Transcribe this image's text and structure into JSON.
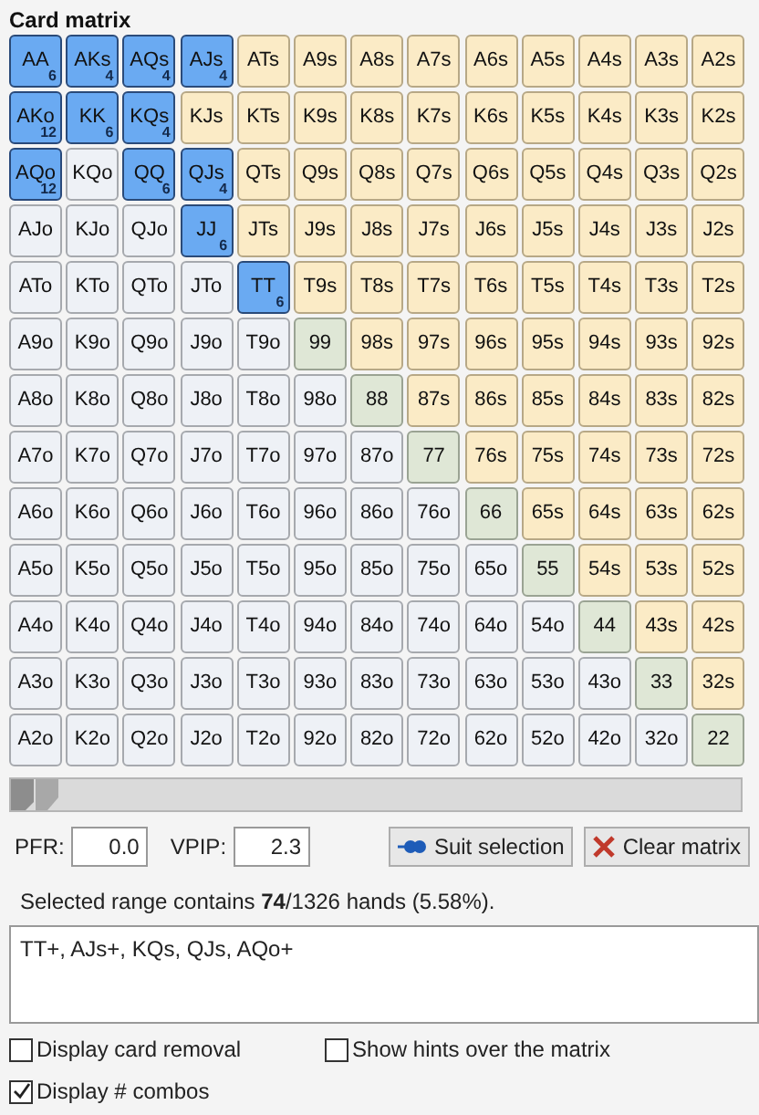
{
  "title": "Card matrix",
  "matrix": [
    [
      {
        "label": "AA",
        "kind": "pair",
        "selected": true,
        "combos": "6"
      },
      {
        "label": "AKs",
        "kind": "suited",
        "selected": true,
        "combos": "4"
      },
      {
        "label": "AQs",
        "kind": "suited",
        "selected": true,
        "combos": "4"
      },
      {
        "label": "AJs",
        "kind": "suited",
        "selected": true,
        "combos": "4"
      },
      {
        "label": "ATs",
        "kind": "suited",
        "selected": false
      },
      {
        "label": "A9s",
        "kind": "suited",
        "selected": false
      },
      {
        "label": "A8s",
        "kind": "suited",
        "selected": false
      },
      {
        "label": "A7s",
        "kind": "suited",
        "selected": false
      },
      {
        "label": "A6s",
        "kind": "suited",
        "selected": false
      },
      {
        "label": "A5s",
        "kind": "suited",
        "selected": false
      },
      {
        "label": "A4s",
        "kind": "suited",
        "selected": false
      },
      {
        "label": "A3s",
        "kind": "suited",
        "selected": false
      },
      {
        "label": "A2s",
        "kind": "suited",
        "selected": false
      }
    ],
    [
      {
        "label": "AKo",
        "kind": "offsuit",
        "selected": true,
        "combos": "12"
      },
      {
        "label": "KK",
        "kind": "pair",
        "selected": true,
        "combos": "6"
      },
      {
        "label": "KQs",
        "kind": "suited",
        "selected": true,
        "combos": "4"
      },
      {
        "label": "KJs",
        "kind": "suited",
        "selected": false
      },
      {
        "label": "KTs",
        "kind": "suited",
        "selected": false
      },
      {
        "label": "K9s",
        "kind": "suited",
        "selected": false
      },
      {
        "label": "K8s",
        "kind": "suited",
        "selected": false
      },
      {
        "label": "K7s",
        "kind": "suited",
        "selected": false
      },
      {
        "label": "K6s",
        "kind": "suited",
        "selected": false
      },
      {
        "label": "K5s",
        "kind": "suited",
        "selected": false
      },
      {
        "label": "K4s",
        "kind": "suited",
        "selected": false
      },
      {
        "label": "K3s",
        "kind": "suited",
        "selected": false
      },
      {
        "label": "K2s",
        "kind": "suited",
        "selected": false
      }
    ],
    [
      {
        "label": "AQo",
        "kind": "offsuit",
        "selected": true,
        "combos": "12"
      },
      {
        "label": "KQo",
        "kind": "offsuit",
        "selected": false
      },
      {
        "label": "QQ",
        "kind": "pair",
        "selected": true,
        "combos": "6"
      },
      {
        "label": "QJs",
        "kind": "suited",
        "selected": true,
        "combos": "4"
      },
      {
        "label": "QTs",
        "kind": "suited",
        "selected": false
      },
      {
        "label": "Q9s",
        "kind": "suited",
        "selected": false
      },
      {
        "label": "Q8s",
        "kind": "suited",
        "selected": false
      },
      {
        "label": "Q7s",
        "kind": "suited",
        "selected": false
      },
      {
        "label": "Q6s",
        "kind": "suited",
        "selected": false
      },
      {
        "label": "Q5s",
        "kind": "suited",
        "selected": false
      },
      {
        "label": "Q4s",
        "kind": "suited",
        "selected": false
      },
      {
        "label": "Q3s",
        "kind": "suited",
        "selected": false
      },
      {
        "label": "Q2s",
        "kind": "suited",
        "selected": false
      }
    ],
    [
      {
        "label": "AJo",
        "kind": "offsuit",
        "selected": false
      },
      {
        "label": "KJo",
        "kind": "offsuit",
        "selected": false
      },
      {
        "label": "QJo",
        "kind": "offsuit",
        "selected": false
      },
      {
        "label": "JJ",
        "kind": "pair",
        "selected": true,
        "combos": "6"
      },
      {
        "label": "JTs",
        "kind": "suited",
        "selected": false
      },
      {
        "label": "J9s",
        "kind": "suited",
        "selected": false
      },
      {
        "label": "J8s",
        "kind": "suited",
        "selected": false
      },
      {
        "label": "J7s",
        "kind": "suited",
        "selected": false
      },
      {
        "label": "J6s",
        "kind": "suited",
        "selected": false
      },
      {
        "label": "J5s",
        "kind": "suited",
        "selected": false
      },
      {
        "label": "J4s",
        "kind": "suited",
        "selected": false
      },
      {
        "label": "J3s",
        "kind": "suited",
        "selected": false
      },
      {
        "label": "J2s",
        "kind": "suited",
        "selected": false
      }
    ],
    [
      {
        "label": "ATo",
        "kind": "offsuit",
        "selected": false
      },
      {
        "label": "KTo",
        "kind": "offsuit",
        "selected": false
      },
      {
        "label": "QTo",
        "kind": "offsuit",
        "selected": false
      },
      {
        "label": "JTo",
        "kind": "offsuit",
        "selected": false
      },
      {
        "label": "TT",
        "kind": "pair",
        "selected": true,
        "combos": "6"
      },
      {
        "label": "T9s",
        "kind": "suited",
        "selected": false
      },
      {
        "label": "T8s",
        "kind": "suited",
        "selected": false
      },
      {
        "label": "T7s",
        "kind": "suited",
        "selected": false
      },
      {
        "label": "T6s",
        "kind": "suited",
        "selected": false
      },
      {
        "label": "T5s",
        "kind": "suited",
        "selected": false
      },
      {
        "label": "T4s",
        "kind": "suited",
        "selected": false
      },
      {
        "label": "T3s",
        "kind": "suited",
        "selected": false
      },
      {
        "label": "T2s",
        "kind": "suited",
        "selected": false
      }
    ],
    [
      {
        "label": "A9o",
        "kind": "offsuit",
        "selected": false
      },
      {
        "label": "K9o",
        "kind": "offsuit",
        "selected": false
      },
      {
        "label": "Q9o",
        "kind": "offsuit",
        "selected": false
      },
      {
        "label": "J9o",
        "kind": "offsuit",
        "selected": false
      },
      {
        "label": "T9o",
        "kind": "offsuit",
        "selected": false
      },
      {
        "label": "99",
        "kind": "pair",
        "selected": false
      },
      {
        "label": "98s",
        "kind": "suited",
        "selected": false
      },
      {
        "label": "97s",
        "kind": "suited",
        "selected": false
      },
      {
        "label": "96s",
        "kind": "suited",
        "selected": false
      },
      {
        "label": "95s",
        "kind": "suited",
        "selected": false
      },
      {
        "label": "94s",
        "kind": "suited",
        "selected": false
      },
      {
        "label": "93s",
        "kind": "suited",
        "selected": false
      },
      {
        "label": "92s",
        "kind": "suited",
        "selected": false
      }
    ],
    [
      {
        "label": "A8o",
        "kind": "offsuit",
        "selected": false
      },
      {
        "label": "K8o",
        "kind": "offsuit",
        "selected": false
      },
      {
        "label": "Q8o",
        "kind": "offsuit",
        "selected": false
      },
      {
        "label": "J8o",
        "kind": "offsuit",
        "selected": false
      },
      {
        "label": "T8o",
        "kind": "offsuit",
        "selected": false
      },
      {
        "label": "98o",
        "kind": "offsuit",
        "selected": false
      },
      {
        "label": "88",
        "kind": "pair",
        "selected": false
      },
      {
        "label": "87s",
        "kind": "suited",
        "selected": false
      },
      {
        "label": "86s",
        "kind": "suited",
        "selected": false
      },
      {
        "label": "85s",
        "kind": "suited",
        "selected": false
      },
      {
        "label": "84s",
        "kind": "suited",
        "selected": false
      },
      {
        "label": "83s",
        "kind": "suited",
        "selected": false
      },
      {
        "label": "82s",
        "kind": "suited",
        "selected": false
      }
    ],
    [
      {
        "label": "A7o",
        "kind": "offsuit",
        "selected": false
      },
      {
        "label": "K7o",
        "kind": "offsuit",
        "selected": false
      },
      {
        "label": "Q7o",
        "kind": "offsuit",
        "selected": false
      },
      {
        "label": "J7o",
        "kind": "offsuit",
        "selected": false
      },
      {
        "label": "T7o",
        "kind": "offsuit",
        "selected": false
      },
      {
        "label": "97o",
        "kind": "offsuit",
        "selected": false
      },
      {
        "label": "87o",
        "kind": "offsuit",
        "selected": false
      },
      {
        "label": "77",
        "kind": "pair",
        "selected": false
      },
      {
        "label": "76s",
        "kind": "suited",
        "selected": false
      },
      {
        "label": "75s",
        "kind": "suited",
        "selected": false
      },
      {
        "label": "74s",
        "kind": "suited",
        "selected": false
      },
      {
        "label": "73s",
        "kind": "suited",
        "selected": false
      },
      {
        "label": "72s",
        "kind": "suited",
        "selected": false
      }
    ],
    [
      {
        "label": "A6o",
        "kind": "offsuit",
        "selected": false
      },
      {
        "label": "K6o",
        "kind": "offsuit",
        "selected": false
      },
      {
        "label": "Q6o",
        "kind": "offsuit",
        "selected": false
      },
      {
        "label": "J6o",
        "kind": "offsuit",
        "selected": false
      },
      {
        "label": "T6o",
        "kind": "offsuit",
        "selected": false
      },
      {
        "label": "96o",
        "kind": "offsuit",
        "selected": false
      },
      {
        "label": "86o",
        "kind": "offsuit",
        "selected": false
      },
      {
        "label": "76o",
        "kind": "offsuit",
        "selected": false
      },
      {
        "label": "66",
        "kind": "pair",
        "selected": false
      },
      {
        "label": "65s",
        "kind": "suited",
        "selected": false
      },
      {
        "label": "64s",
        "kind": "suited",
        "selected": false
      },
      {
        "label": "63s",
        "kind": "suited",
        "selected": false
      },
      {
        "label": "62s",
        "kind": "suited",
        "selected": false
      }
    ],
    [
      {
        "label": "A5o",
        "kind": "offsuit",
        "selected": false
      },
      {
        "label": "K5o",
        "kind": "offsuit",
        "selected": false
      },
      {
        "label": "Q5o",
        "kind": "offsuit",
        "selected": false
      },
      {
        "label": "J5o",
        "kind": "offsuit",
        "selected": false
      },
      {
        "label": "T5o",
        "kind": "offsuit",
        "selected": false
      },
      {
        "label": "95o",
        "kind": "offsuit",
        "selected": false
      },
      {
        "label": "85o",
        "kind": "offsuit",
        "selected": false
      },
      {
        "label": "75o",
        "kind": "offsuit",
        "selected": false
      },
      {
        "label": "65o",
        "kind": "offsuit",
        "selected": false
      },
      {
        "label": "55",
        "kind": "pair",
        "selected": false
      },
      {
        "label": "54s",
        "kind": "suited",
        "selected": false
      },
      {
        "label": "53s",
        "kind": "suited",
        "selected": false
      },
      {
        "label": "52s",
        "kind": "suited",
        "selected": false
      }
    ],
    [
      {
        "label": "A4o",
        "kind": "offsuit",
        "selected": false
      },
      {
        "label": "K4o",
        "kind": "offsuit",
        "selected": false
      },
      {
        "label": "Q4o",
        "kind": "offsuit",
        "selected": false
      },
      {
        "label": "J4o",
        "kind": "offsuit",
        "selected": false
      },
      {
        "label": "T4o",
        "kind": "offsuit",
        "selected": false
      },
      {
        "label": "94o",
        "kind": "offsuit",
        "selected": false
      },
      {
        "label": "84o",
        "kind": "offsuit",
        "selected": false
      },
      {
        "label": "74o",
        "kind": "offsuit",
        "selected": false
      },
      {
        "label": "64o",
        "kind": "offsuit",
        "selected": false
      },
      {
        "label": "54o",
        "kind": "offsuit",
        "selected": false
      },
      {
        "label": "44",
        "kind": "pair",
        "selected": false
      },
      {
        "label": "43s",
        "kind": "suited",
        "selected": false
      },
      {
        "label": "42s",
        "kind": "suited",
        "selected": false
      }
    ],
    [
      {
        "label": "A3o",
        "kind": "offsuit",
        "selected": false
      },
      {
        "label": "K3o",
        "kind": "offsuit",
        "selected": false
      },
      {
        "label": "Q3o",
        "kind": "offsuit",
        "selected": false
      },
      {
        "label": "J3o",
        "kind": "offsuit",
        "selected": false
      },
      {
        "label": "T3o",
        "kind": "offsuit",
        "selected": false
      },
      {
        "label": "93o",
        "kind": "offsuit",
        "selected": false
      },
      {
        "label": "83o",
        "kind": "offsuit",
        "selected": false
      },
      {
        "label": "73o",
        "kind": "offsuit",
        "selected": false
      },
      {
        "label": "63o",
        "kind": "offsuit",
        "selected": false
      },
      {
        "label": "53o",
        "kind": "offsuit",
        "selected": false
      },
      {
        "label": "43o",
        "kind": "offsuit",
        "selected": false
      },
      {
        "label": "33",
        "kind": "pair",
        "selected": false
      },
      {
        "label": "32s",
        "kind": "suited",
        "selected": false
      }
    ],
    [
      {
        "label": "A2o",
        "kind": "offsuit",
        "selected": false
      },
      {
        "label": "K2o",
        "kind": "offsuit",
        "selected": false
      },
      {
        "label": "Q2o",
        "kind": "offsuit",
        "selected": false
      },
      {
        "label": "J2o",
        "kind": "offsuit",
        "selected": false
      },
      {
        "label": "T2o",
        "kind": "offsuit",
        "selected": false
      },
      {
        "label": "92o",
        "kind": "offsuit",
        "selected": false
      },
      {
        "label": "82o",
        "kind": "offsuit",
        "selected": false
      },
      {
        "label": "72o",
        "kind": "offsuit",
        "selected": false
      },
      {
        "label": "62o",
        "kind": "offsuit",
        "selected": false
      },
      {
        "label": "52o",
        "kind": "offsuit",
        "selected": false
      },
      {
        "label": "42o",
        "kind": "offsuit",
        "selected": false
      },
      {
        "label": "32o",
        "kind": "offsuit",
        "selected": false
      },
      {
        "label": "22",
        "kind": "pair",
        "selected": false
      }
    ]
  ],
  "slider": {
    "level": 0.0
  },
  "pfr": {
    "label": "PFR:",
    "value": "0.0"
  },
  "vpip": {
    "label": "VPIP:",
    "value": "2.3"
  },
  "buttons": [
    {
      "kind": "suit",
      "label": "Suit selection"
    },
    {
      "kind": "clear",
      "label": "Clear matrix"
    }
  ],
  "summary": "Selected range contains **74**/1326 hands (5.58%).",
  "range_text": "TT+, AJs+, KQs, QJs, AQo+",
  "options": [
    {
      "label": "Display card removal",
      "checked": false
    },
    {
      "label": "Show hints over the matrix",
      "checked": false
    },
    {
      "label": "Display # combos",
      "checked": true
    }
  ]
}
